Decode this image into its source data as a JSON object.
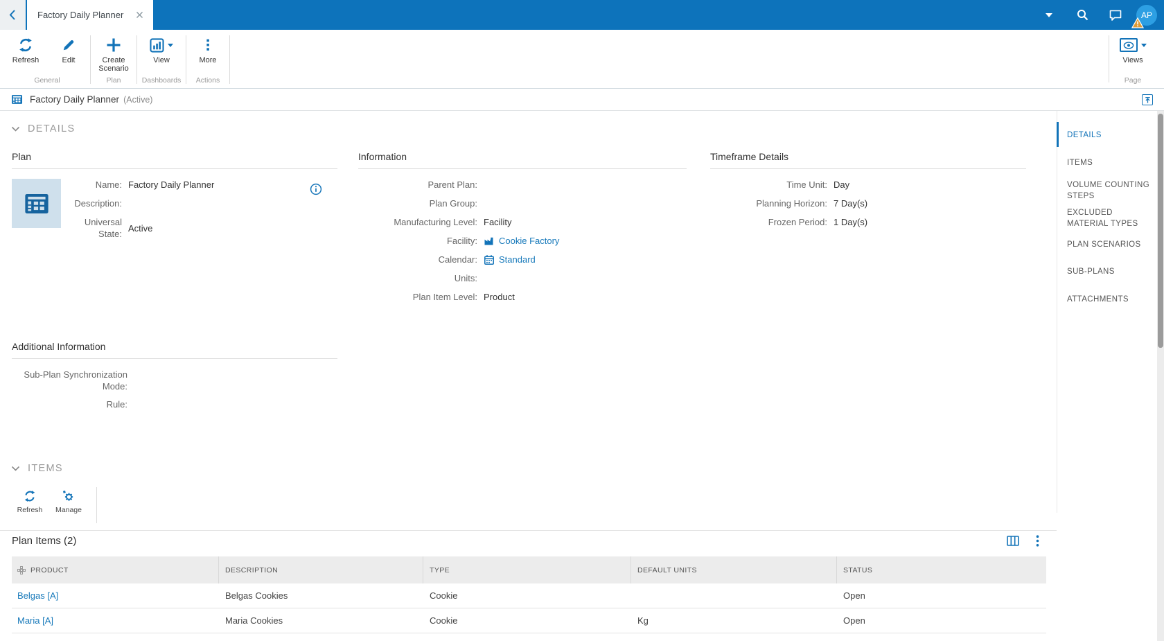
{
  "topbar": {
    "tab_title": "Factory Daily Planner",
    "avatar_initials": "AP"
  },
  "ribbon": {
    "groups": [
      {
        "caption": "General",
        "buttons": [
          {
            "label": "Refresh"
          },
          {
            "label": "Edit"
          }
        ]
      },
      {
        "caption": "Plan",
        "buttons": [
          {
            "label": "Create Scenario"
          }
        ]
      },
      {
        "caption": "Dashboards",
        "buttons": [
          {
            "label": "View"
          }
        ]
      },
      {
        "caption": "Actions",
        "buttons": [
          {
            "label": "More"
          }
        ]
      }
    ],
    "views": {
      "label": "Views",
      "caption": "Page"
    }
  },
  "breadcrumb": {
    "title": "Factory Daily Planner",
    "status": "(Active)"
  },
  "sections": {
    "details": "DETAILS",
    "items": "ITEMS"
  },
  "plan": {
    "heading": "Plan",
    "fields": [
      {
        "label": "Name:",
        "value": "Factory Daily Planner"
      },
      {
        "label": "Description:",
        "value": ""
      },
      {
        "label": "Universal State:",
        "value": "Active"
      }
    ]
  },
  "information": {
    "heading": "Information",
    "fields": [
      {
        "label": "Parent Plan:",
        "value": ""
      },
      {
        "label": "Plan Group:",
        "value": ""
      },
      {
        "label": "Manufacturing Level:",
        "value": "Facility"
      },
      {
        "label": "Facility:",
        "value": "Cookie Factory",
        "link": true,
        "icon": "factory-icon"
      },
      {
        "label": "Calendar:",
        "value": "Standard",
        "link": true,
        "icon": "calendar-icon"
      },
      {
        "label": "Units:",
        "value": ""
      },
      {
        "label": "Plan Item Level:",
        "value": "Product"
      }
    ]
  },
  "timeframe": {
    "heading": "Timeframe Details",
    "fields": [
      {
        "label": "Time Unit:",
        "value": "Day"
      },
      {
        "label": "Planning Horizon:",
        "value": "7 Day(s)"
      },
      {
        "label": "Frozen Period:",
        "value": "1 Day(s)"
      }
    ]
  },
  "additional": {
    "heading": "Additional Information",
    "fields": [
      {
        "label": "Sub-Plan Synchronization Mode:",
        "value": ""
      },
      {
        "label": "Rule:",
        "value": ""
      }
    ]
  },
  "items_toolbar": {
    "buttons": [
      {
        "label": "Refresh"
      },
      {
        "label": "Manage"
      }
    ]
  },
  "plan_items": {
    "heading": "Plan Items (2)",
    "columns": [
      "PRODUCT",
      "DESCRIPTION",
      "TYPE",
      "DEFAULT UNITS",
      "STATUS"
    ],
    "rows": [
      [
        "Belgas [A]",
        "Belgas Cookies",
        "Cookie",
        "",
        "Open"
      ],
      [
        "Maria [A]",
        "Maria Cookies",
        "Cookie",
        "Kg",
        "Open"
      ]
    ]
  },
  "sidebar": {
    "items": [
      {
        "label": "DETAILS",
        "active": true
      },
      {
        "label": "ITEMS",
        "active": false
      },
      {
        "label": "VOLUME COUNTING STEPS",
        "active": false
      },
      {
        "label": "EXCLUDED MATERIAL TYPES",
        "active": false
      },
      {
        "label": "PLAN SCENARIOS",
        "active": false
      },
      {
        "label": "SUB-PLANS",
        "active": false
      },
      {
        "label": "ATTACHMENTS",
        "active": false
      }
    ]
  },
  "colors": {
    "topbar_blue": "#0d73bb",
    "accent_blue": "#1273b8",
    "link_blue": "#1779ba",
    "avatar_blue": "#2d9fe3",
    "warning_amber": "#dd9a35",
    "table_header_bg": "#ececec"
  },
  "icons": [
    "back-icon",
    "close-icon",
    "caret-down-icon",
    "search-icon",
    "chat-icon",
    "warning-icon",
    "refresh-icon",
    "edit-icon",
    "plus-icon",
    "bar-chart-icon",
    "kebab-icon",
    "eye-icon",
    "plan-icon",
    "info-icon",
    "factory-icon",
    "calendar-icon",
    "gear-icon",
    "columns-icon",
    "move-icon",
    "expand-icon",
    "chevron-down-icon"
  ]
}
